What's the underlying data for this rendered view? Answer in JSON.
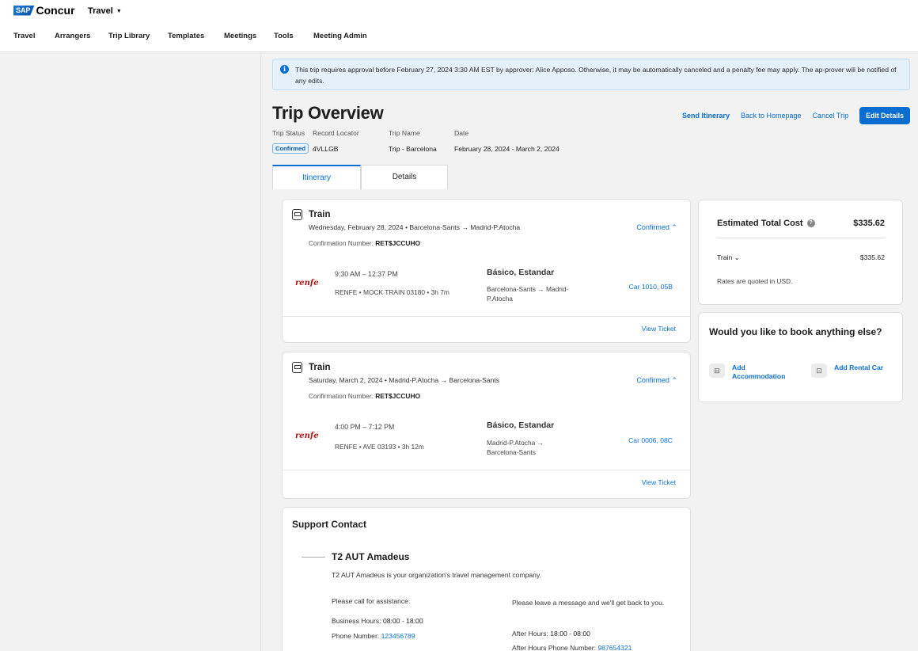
{
  "header": {
    "brand_sap": "SAP",
    "brand_name": "Concur",
    "app_switcher": "Travel",
    "nav": [
      "Travel",
      "Arrangers",
      "Trip Library",
      "Templates",
      "Meetings",
      "Tools",
      "Meeting Admin"
    ]
  },
  "alert": {
    "text": "This trip requires approval before February 27, 2024 3:30 AM EST by approver: Alice Apposo. Otherwise, it may be automatically canceled and a penalty fee may apply. The ap-prover will be notified of any edits."
  },
  "trip": {
    "title": "Trip Overview",
    "actions": {
      "send_itinerary": "Send Itinerary",
      "back_home": "Back to Homepage",
      "cancel_trip": "Cancel Trip",
      "edit_details": "Edit Details"
    },
    "meta_labels": {
      "status": "Trip Status",
      "locator": "Record Locator",
      "name": "Trip Name",
      "date": "Date"
    },
    "meta_values": {
      "status": "Confirmed",
      "locator": "4VLLGB",
      "name": "Trip - Barcelona",
      "date": "February 28, 2024 - March 2, 2024"
    }
  },
  "tabs": [
    "Itinerary",
    "Details"
  ],
  "segments": [
    {
      "type": "Train",
      "summary": "Wednesday, February 28, 2024  •  Barcelona-Sants  →  Madrid-P.Atocha",
      "confirmation_label": "Confirmation Number:",
      "confirmation_number": "RET$JCCUHO",
      "status": "Confirmed",
      "carrier_logo": "renfe",
      "time": "9:30 AM  –  12:37 PM",
      "operator": "RENFE  •  MOCK TRAIN 03180  •  3h 7m",
      "fare": "Básico, Estandar",
      "route": "Barcelona-Sants → Madrid-P.Atocha",
      "car": "Car 1010, 05B",
      "view_ticket": "View Ticket"
    },
    {
      "type": "Train",
      "summary": "Saturday, March 2, 2024  •  Madrid-P.Atocha  →  Barcelona-Sants",
      "confirmation_label": "Confirmation Number:",
      "confirmation_number": "RET$JCCUHO",
      "status": "Confirmed",
      "carrier_logo": "renfe",
      "time": "4:00 PM  –  7:12 PM",
      "operator": "RENFE  •  AVE 03193  •  3h 12m",
      "fare": "Básico, Estandar",
      "route": "Madrid-P.Atocha → Barcelona-Sants",
      "car": "Car 0006, 08C",
      "view_ticket": "View Ticket"
    }
  ],
  "cost": {
    "title": "Estimated Total Cost",
    "total": "$335.62",
    "line_label": "Train",
    "line_value": "$335.62",
    "note": "Rates are quoted in USD."
  },
  "book_more": {
    "title": "Would you like to book anything else?",
    "accommodation": "Add Accommodation",
    "rental_car": "Add Rental Car"
  },
  "support": {
    "title": "Support Contact",
    "agency": "T2 AUT Amadeus",
    "description": "T2 AUT Amadeus is your organization's travel management company.",
    "call_text": "Please call for assistance.",
    "hours_label": "Business Hours:",
    "hours_value": "08:00 - 18:00",
    "phone_label": "Phone Number:",
    "phone_value": "123456789",
    "message_text": "Please leave a message and we'll get back to you.",
    "after_hours_label": "After Hours:",
    "after_hours_value": "18:00 - 08:00",
    "after_phone_label": "After Hours Phone Number:",
    "after_phone_value": "987654321"
  },
  "colors": {
    "accent": "#0a6ed1",
    "alert_bg": "#e4f1fb",
    "renfe": "#b01a1a"
  }
}
